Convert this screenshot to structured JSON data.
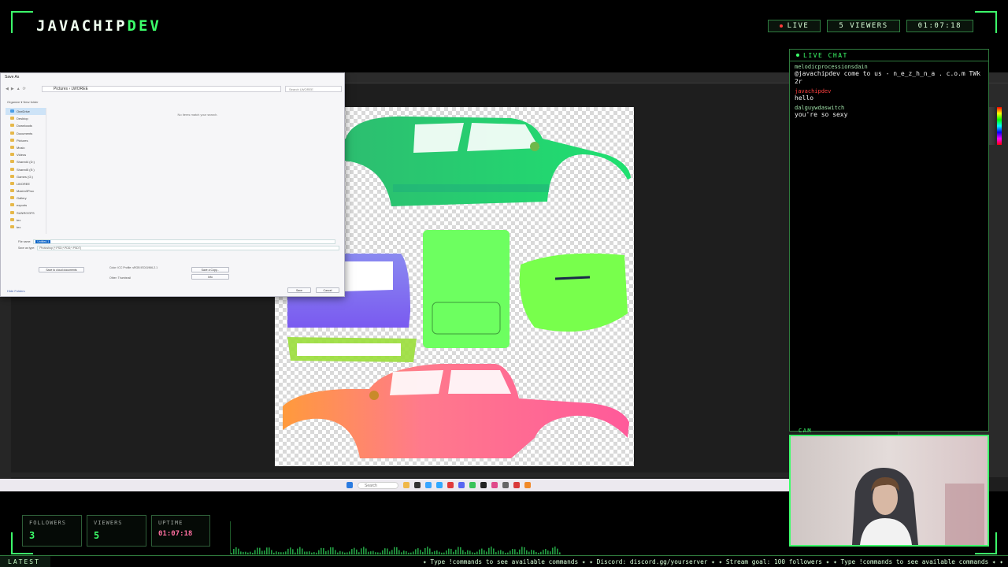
{
  "overlay": {
    "brand_main": "JAVACHIP",
    "brand_accent": "DEV",
    "live_label": "LIVE",
    "viewers_label": "5  VIEWERS",
    "clock": "01:07:18",
    "accent_color": "#3cff6a"
  },
  "chat": {
    "title": "LIVE CHAT",
    "messages": [
      {
        "user": "melodicprocessionsdain",
        "text": "@javachipdev come to us - n_e_z_h_n_a . c.o.m TWk2r"
      },
      {
        "user": "javachipdev",
        "text": "hello"
      },
      {
        "user": "dalguywdaswitch",
        "text": "you're so sexy"
      }
    ]
  },
  "cam": {
    "label": "CAM"
  },
  "stats": {
    "followers_label": "FOLLOWERS",
    "followers_value": "3",
    "viewers_label": "VIEWERS",
    "viewers_value": "5",
    "uptime_label": "UPTIME",
    "uptime_value": "01:07:18"
  },
  "ticker": {
    "latest_label": "LATEST",
    "text": "✦ Type !commands to see available commands ✦ ✦ Discord: discord.gg/yourserver ✦ ✦ Stream goal: 100 followers ✦ ✦ Type !commands to see available commands ✦ ✦"
  },
  "dialog": {
    "title": "Save As",
    "address": "Pictures › LWOREE",
    "search_placeholder": "Search LWOREE",
    "toolbar": "Organize ▾   New folder",
    "empty_text": "No items match your search.",
    "sidebar": [
      "OneDrive",
      "Desktop",
      "Downloads",
      "Documents",
      "Pictures",
      "Music",
      "Videos",
      "Shared4 (D:)",
      "Shared5 (E:)",
      "Games (G:)",
      "LWOREE",
      "Maxim3Proc",
      "Gallery",
      "exports",
      "SUNROOFS",
      "tex",
      "tex"
    ],
    "filename_label": "File name:",
    "filename_value": "Untitled-1",
    "type_label": "Save as type:",
    "type_value": "Photoshop (*.PSD;*.PDD;*.PSDT)",
    "cloud_button": "Save to cloud documents",
    "color_label": "Color:",
    "color_value": "ICC Profile: sRGB IEC61966-2.1",
    "other_label": "Other:",
    "other_value": "Thumbnail",
    "copy_button": "Save a Copy...",
    "info_button": "Info",
    "hide_folders": "Hide Folders",
    "save_button": "Save",
    "cancel_button": "Cancel"
  },
  "taskbar": {
    "search_label": "Search"
  }
}
